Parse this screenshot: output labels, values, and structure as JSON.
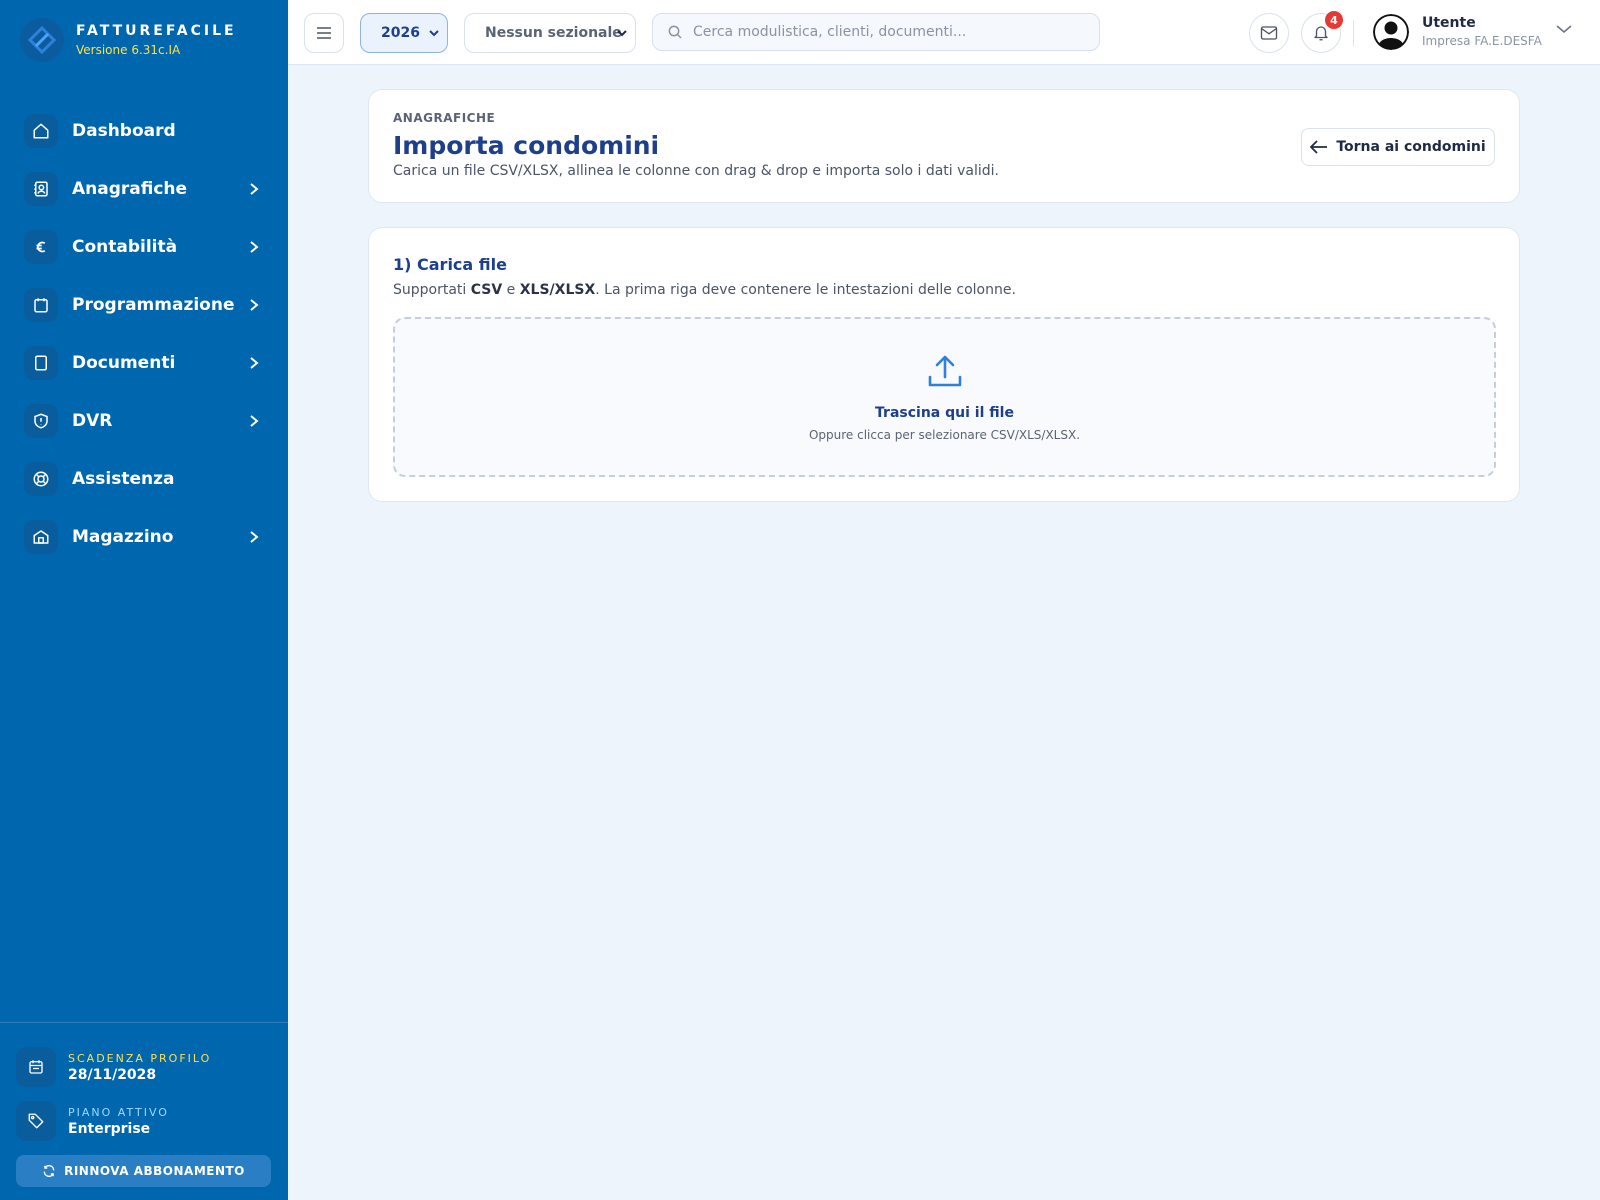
{
  "brand": {
    "name": "FATTUREFACILE",
    "version": "Versione 6.31c.IA"
  },
  "sidebar": {
    "items": [
      {
        "label": "Dashboard",
        "icon": "home-icon",
        "has_submenu": false
      },
      {
        "label": "Anagrafiche",
        "icon": "contacts-icon",
        "has_submenu": true
      },
      {
        "label": "Contabilità",
        "icon": "euro-icon",
        "has_submenu": true
      },
      {
        "label": "Programmazione",
        "icon": "calendar-icon",
        "has_submenu": true
      },
      {
        "label": "Documenti",
        "icon": "document-icon",
        "has_submenu": true
      },
      {
        "label": "DVR",
        "icon": "shield-icon",
        "has_submenu": true
      },
      {
        "label": "Assistenza",
        "icon": "lifebuoy-icon",
        "has_submenu": false
      },
      {
        "label": "Magazzino",
        "icon": "warehouse-icon",
        "has_submenu": true
      }
    ],
    "footer": {
      "expiry_label": "SCADENZA PROFILO",
      "expiry_value": "28/11/2028",
      "plan_label": "PIANO ATTIVO",
      "plan_value": "Enterprise",
      "renew_label": "RINNOVA ABBONAMENTO"
    }
  },
  "topbar": {
    "year": "2026",
    "sezionale": "Nessun sezionale",
    "search_placeholder": "Cerca modulistica, clienti, documenti...",
    "notifications_count": "4",
    "user_name": "Utente",
    "user_company": "Impresa FA.E.DESFA"
  },
  "header": {
    "kicker": "ANAGRAFICHE",
    "title": "Importa condomini",
    "subtitle": "Carica un file CSV/XLSX, allinea le colonne con drag & drop e importa solo i dati validi.",
    "back_label": "Torna ai condomini"
  },
  "upload": {
    "step_title": "1) Carica file",
    "desc_prefix": "Supportati ",
    "desc_csv": "CSV",
    "desc_and": " e ",
    "desc_xls": "XLS/XLSX",
    "desc_suffix": ". La prima riga deve contenere le intestazioni delle colonne.",
    "drop_title": "Trascina qui il file",
    "drop_hint": "Oppure clicca per selezionare CSV/XLS/XLSX."
  },
  "colors": {
    "sidebar_bg": "#0066ad",
    "accent_yellow": "#ffe04d",
    "title_blue": "#1e3f8a",
    "upload_icon": "#2f80d8",
    "badge_red": "#e53935"
  }
}
